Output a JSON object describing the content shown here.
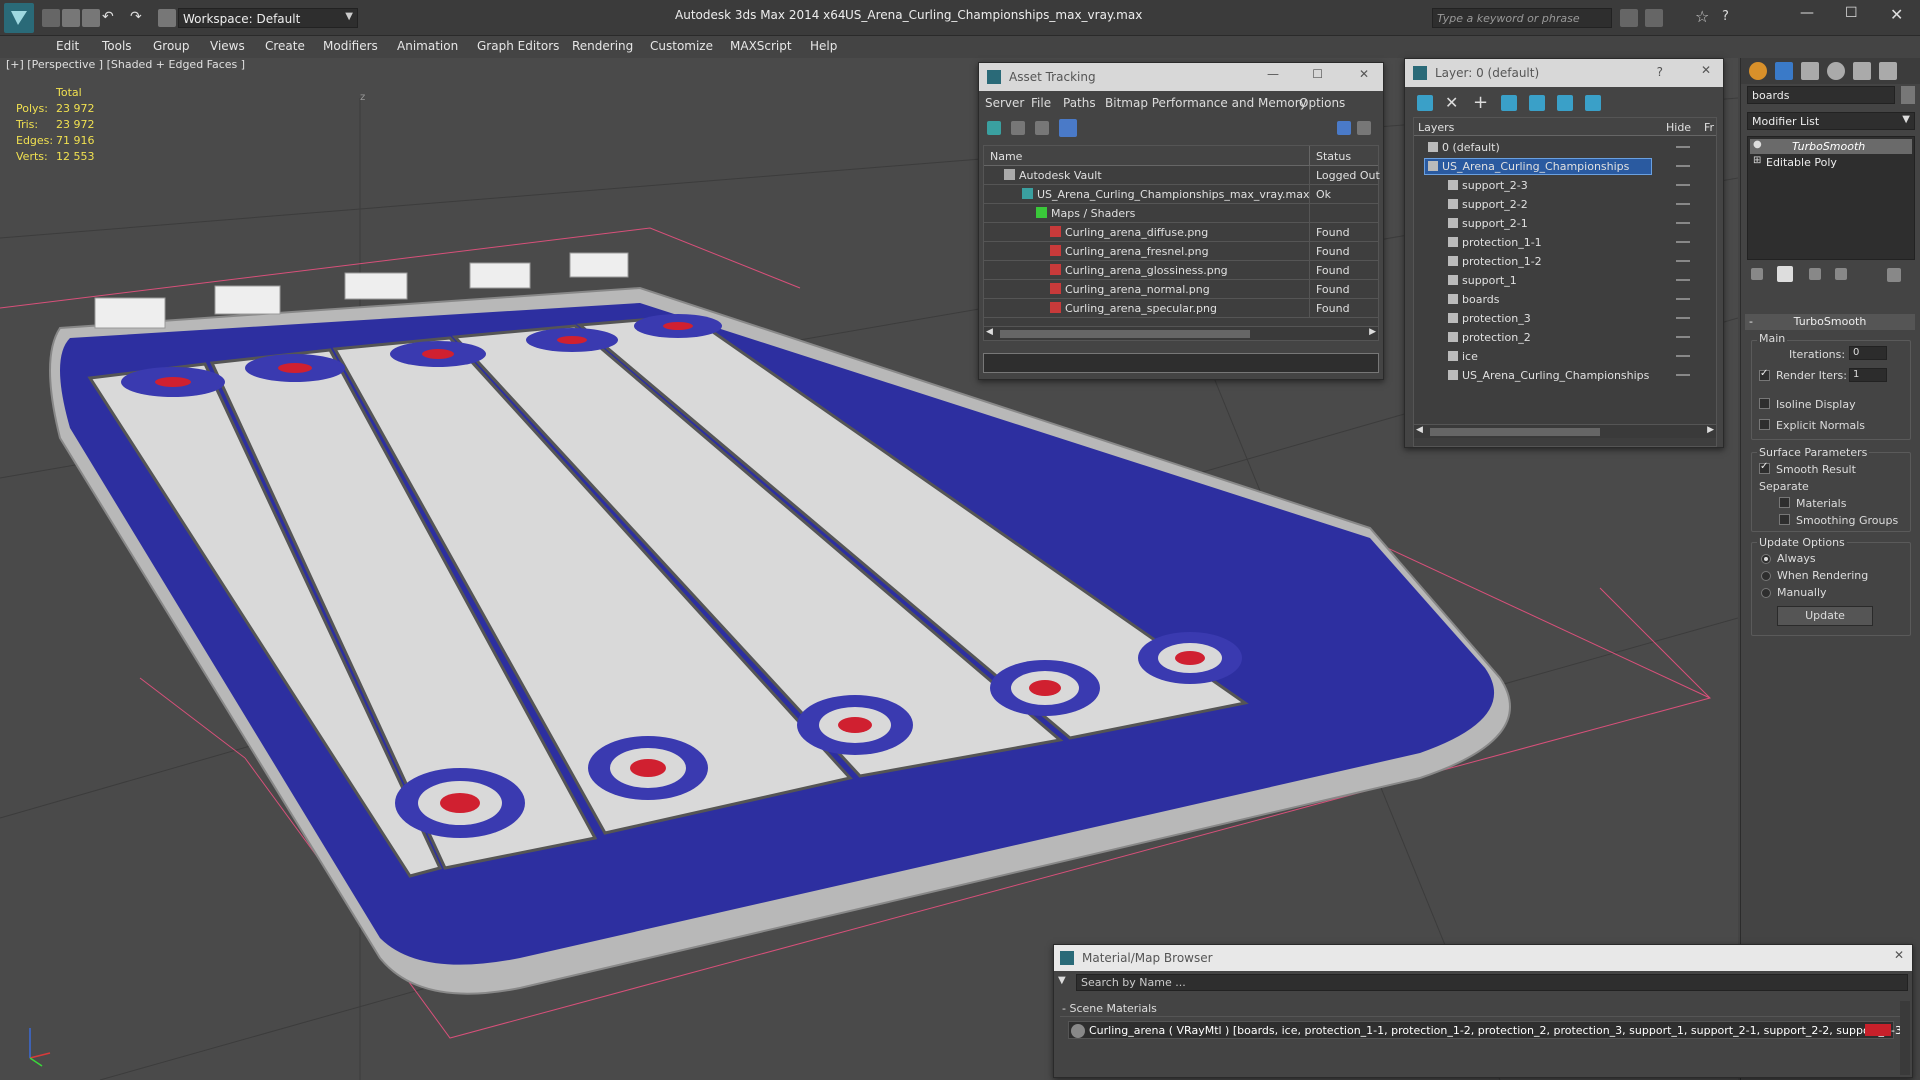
{
  "titlebar": {
    "workspace_label": "Workspace: Default",
    "app_title": "Autodesk 3ds Max  2014 x64",
    "file_title": "US_Arena_Curling_Championships_max_vray.max",
    "search_placeholder": "Type a keyword or phrase"
  },
  "menu": [
    "Edit",
    "Tools",
    "Group",
    "Views",
    "Create",
    "Modifiers",
    "Animation",
    "Graph Editors",
    "Rendering",
    "Customize",
    "MAXScript",
    "Help"
  ],
  "viewport": {
    "label": "[+] [Perspective ] [Shaded + Edged Faces ]",
    "stats": {
      "header": "Total",
      "rows": [
        {
          "k": "Polys:",
          "v": "23 972"
        },
        {
          "k": "Tris:",
          "v": "23 972"
        },
        {
          "k": "Edges:",
          "v": "71 916"
        },
        {
          "k": "Verts:",
          "v": "12 553"
        }
      ]
    },
    "axis_z": "z",
    "colors": {
      "ice": "#d9d9d9",
      "rink_blue": "#2d2fa0",
      "house_blue": "#3a3ab0",
      "house_red": "#d02030",
      "boards": "#c8c8c8"
    }
  },
  "asset_tracking": {
    "title": "Asset Tracking",
    "menu": [
      "Server",
      "File",
      "Paths",
      "Bitmap Performance and Memory",
      "Options"
    ],
    "columns": [
      "Name",
      "Status"
    ],
    "rows": [
      {
        "name": "Autodesk Vault",
        "status": "Logged Out",
        "icon": "vault-icon"
      },
      {
        "name": "US_Arena_Curling_Championships_max_vray.max",
        "status": "Ok",
        "icon": "max-file-icon"
      },
      {
        "name": "Maps / Shaders",
        "status": "",
        "icon": "maps-icon"
      },
      {
        "name": "Curling_arena_diffuse.png",
        "status": "Found",
        "icon": "png-icon"
      },
      {
        "name": "Curling_arena_fresnel.png",
        "status": "Found",
        "icon": "png-icon"
      },
      {
        "name": "Curling_arena_glossiness.png",
        "status": "Found",
        "icon": "png-icon"
      },
      {
        "name": "Curling_arena_normal.png",
        "status": "Found",
        "icon": "png-icon"
      },
      {
        "name": "Curling_arena_specular.png",
        "status": "Found",
        "icon": "png-icon"
      }
    ]
  },
  "layer_panel": {
    "title": "Layer: 0 (default)",
    "help": "?",
    "columns": [
      "Layers",
      "Hide",
      "Fr"
    ],
    "layers": [
      {
        "name": "0 (default)",
        "level": 0,
        "selected": false
      },
      {
        "name": "US_Arena_Curling_Championships",
        "level": 0,
        "selected": true
      },
      {
        "name": "support_2-3",
        "level": 1,
        "selected": false
      },
      {
        "name": "support_2-2",
        "level": 1,
        "selected": false
      },
      {
        "name": "support_2-1",
        "level": 1,
        "selected": false
      },
      {
        "name": "protection_1-1",
        "level": 1,
        "selected": false
      },
      {
        "name": "protection_1-2",
        "level": 1,
        "selected": false
      },
      {
        "name": "support_1",
        "level": 1,
        "selected": false
      },
      {
        "name": "boards",
        "level": 1,
        "selected": false
      },
      {
        "name": "protection_3",
        "level": 1,
        "selected": false
      },
      {
        "name": "protection_2",
        "level": 1,
        "selected": false
      },
      {
        "name": "ice",
        "level": 1,
        "selected": false
      },
      {
        "name": "US_Arena_Curling_Championships",
        "level": 1,
        "selected": false
      }
    ]
  },
  "command_panel": {
    "object_name": "boards",
    "modifier_list": "Modifier List",
    "stack": [
      "TurboSmooth",
      "Editable Poly"
    ],
    "turbosmooth": {
      "title": "TurboSmooth",
      "main_label": "Main",
      "iterations_label": "Iterations:",
      "iterations": "0",
      "render_iters_label": "Render Iters:",
      "render_iters": "1",
      "isoline": "Isoline Display",
      "explicit": "Explicit Normals",
      "surface_label": "Surface Parameters",
      "smooth_result": "Smooth Result",
      "separate_label": "Separate",
      "materials": "Materials",
      "smoothing_groups": "Smoothing Groups",
      "update_label": "Update Options",
      "always": "Always",
      "when_rendering": "When Rendering",
      "manually": "Manually",
      "update_button": "Update"
    }
  },
  "material_browser": {
    "title": "Material/Map Browser",
    "search_placeholder": "Search by Name ...",
    "section": "- Scene Materials",
    "entry": "Curling_arena  ( VRayMtl ) [boards, ice, protection_1-1, protection_1-2, protection_2, protection_3, support_1, support_2-1, support_2-2, support_2-3]"
  }
}
